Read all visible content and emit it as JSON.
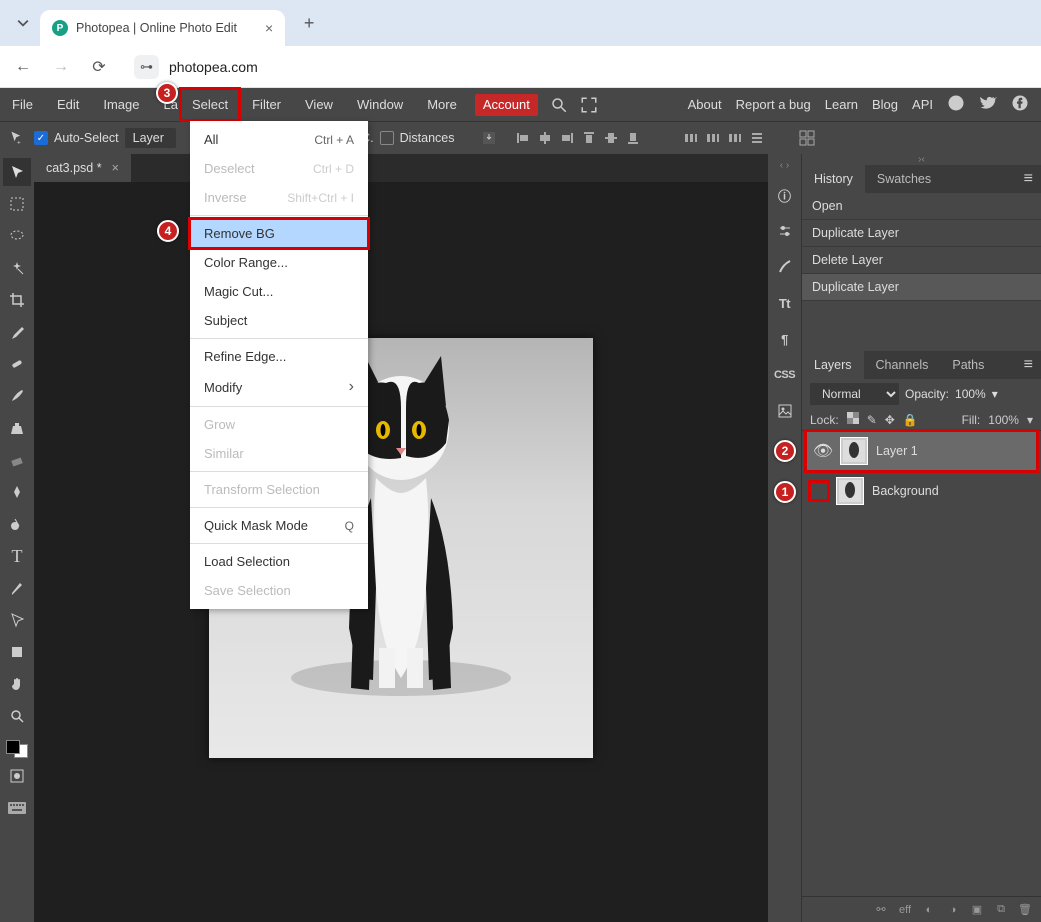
{
  "browser": {
    "tab_title": "Photopea | Online Photo Edit",
    "url": "photopea.com"
  },
  "menu": {
    "items": [
      "File",
      "Edit",
      "Image",
      "Layer",
      "Select",
      "Filter",
      "View",
      "Window",
      "More"
    ],
    "account": "Account",
    "right": [
      "About",
      "Report a bug",
      "Learn",
      "Blog",
      "API"
    ]
  },
  "options": {
    "auto_select": "Auto-Select",
    "layer_drop": "Layer",
    "tc": "T. C.",
    "distances": "Distances"
  },
  "doc_tab": "cat3.psd *",
  "dropdown": [
    {
      "label": "All",
      "shortcut": "Ctrl + A",
      "disabled": false
    },
    {
      "label": "Deselect",
      "shortcut": "Ctrl + D",
      "disabled": true
    },
    {
      "label": "Inverse",
      "shortcut": "Shift+Ctrl + I",
      "disabled": true
    },
    {
      "sep": true
    },
    {
      "label": "Remove BG",
      "hover": true
    },
    {
      "label": "Color Range..."
    },
    {
      "label": "Magic Cut..."
    },
    {
      "label": "Subject"
    },
    {
      "sep": true
    },
    {
      "label": "Refine Edge..."
    },
    {
      "label": "Modify",
      "sub": true
    },
    {
      "sep": true
    },
    {
      "label": "Grow",
      "disabled": true
    },
    {
      "label": "Similar",
      "disabled": true
    },
    {
      "sep": true
    },
    {
      "label": "Transform Selection",
      "disabled": true
    },
    {
      "sep": true
    },
    {
      "label": "Quick Mask Mode",
      "shortcut": "Q"
    },
    {
      "sep": true
    },
    {
      "label": "Load Selection"
    },
    {
      "label": "Save Selection",
      "disabled": true
    }
  ],
  "history": {
    "tabs": [
      "History",
      "Swatches"
    ],
    "items": [
      "Open",
      "Duplicate Layer",
      "Delete Layer",
      "Duplicate Layer"
    ]
  },
  "layers_panel": {
    "tabs": [
      "Layers",
      "Channels",
      "Paths"
    ],
    "blend": "Normal",
    "opacity_label": "Opacity:",
    "opacity": "100%",
    "lock_label": "Lock:",
    "fill_label": "Fill:",
    "fill": "100%",
    "layers": [
      {
        "name": "Layer 1",
        "visible": true,
        "selected": true
      },
      {
        "name": "Background",
        "visible": false,
        "selected": false
      }
    ]
  },
  "mini_labels": {
    "tt": "Tt",
    "pilcrow": "¶",
    "css": "CSS"
  },
  "footer": {
    "eff": "eff"
  },
  "annot": {
    "b1": "1",
    "b2": "2",
    "b3": "3",
    "b4": "4"
  }
}
